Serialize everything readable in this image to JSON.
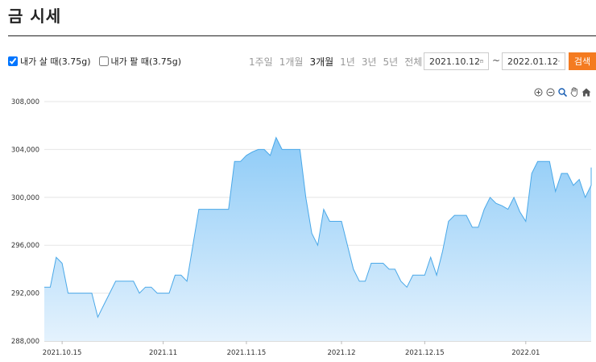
{
  "page": {
    "title": "금 시세"
  },
  "legend": {
    "buy_label": "내가 살 때(3.75g)",
    "buy_checked": true,
    "sell_label": "내가 팔 때(3.75g)",
    "sell_checked": false
  },
  "periods": [
    "1주일",
    "1개월",
    "3개월",
    "1년",
    "3년",
    "5년",
    "전체"
  ],
  "active_period": "3개월",
  "dates": {
    "start": "2021.10.12",
    "end": "2022.01.12",
    "separator": "~"
  },
  "search_label": "검색",
  "toolbar_icons": [
    "zoom-in-icon",
    "zoom-out-icon",
    "zoom-select-icon",
    "pan-hand-icon",
    "home-icon"
  ],
  "colors": {
    "accent": "#f47b20",
    "line": "#4aa8e8",
    "fill_top": "#8ecbf7",
    "fill_bottom": "#e4f2fd"
  },
  "chart_data": {
    "type": "area",
    "yticks": [
      288000,
      292000,
      296000,
      300000,
      304000,
      308000
    ],
    "ytick_labels": [
      "288,000",
      "292,000",
      "296,000",
      "300,000",
      "304,000",
      "308,000"
    ],
    "ylim": [
      288000,
      308000
    ],
    "xlim": [
      "2021-10-12",
      "2022-01-12"
    ],
    "xticks": [
      "2021-10-15",
      "2021-11-01",
      "2021-11-15",
      "2021-12-01",
      "2021-12-15",
      "2022-01-01"
    ],
    "xtick_labels": [
      "2021.10.15",
      "2021.11",
      "2021.11.15",
      "2021.12",
      "2021.12.15",
      "2022.01"
    ],
    "grid": true,
    "series": [
      {
        "values": [
          [
            "2021-10-12",
            292500
          ],
          [
            "2021-10-13",
            292500
          ],
          [
            "2021-10-14",
            295000
          ],
          [
            "2021-10-15",
            294500
          ],
          [
            "2021-10-16",
            292000
          ],
          [
            "2021-10-18",
            292000
          ],
          [
            "2021-10-20",
            292000
          ],
          [
            "2021-10-21",
            290000
          ],
          [
            "2021-10-22",
            291000
          ],
          [
            "2021-10-23",
            292000
          ],
          [
            "2021-10-24",
            293000
          ],
          [
            "2021-10-25",
            293000
          ],
          [
            "2021-10-27",
            293000
          ],
          [
            "2021-10-28",
            292000
          ],
          [
            "2021-10-29",
            292500
          ],
          [
            "2021-10-30",
            292500
          ],
          [
            "2021-10-31",
            292000
          ],
          [
            "2021-11-02",
            292000
          ],
          [
            "2021-11-03",
            293500
          ],
          [
            "2021-11-04",
            293500
          ],
          [
            "2021-11-05",
            293000
          ],
          [
            "2021-11-06",
            296000
          ],
          [
            "2021-11-07",
            299000
          ],
          [
            "2021-11-08",
            299000
          ],
          [
            "2021-11-10",
            299000
          ],
          [
            "2021-11-12",
            299000
          ],
          [
            "2021-11-13",
            303000
          ],
          [
            "2021-11-14",
            303000
          ],
          [
            "2021-11-15",
            303500
          ],
          [
            "2021-11-16",
            303800
          ],
          [
            "2021-11-17",
            304000
          ],
          [
            "2021-11-18",
            304000
          ],
          [
            "2021-11-19",
            303500
          ],
          [
            "2021-11-20",
            305000
          ],
          [
            "2021-11-21",
            304000
          ],
          [
            "2021-11-23",
            304000
          ],
          [
            "2021-11-24",
            304000
          ],
          [
            "2021-11-25",
            300000
          ],
          [
            "2021-11-26",
            297000
          ],
          [
            "2021-11-27",
            296000
          ],
          [
            "2021-11-28",
            299000
          ],
          [
            "2021-11-29",
            298000
          ],
          [
            "2021-11-30",
            298000
          ],
          [
            "2021-12-01",
            298000
          ],
          [
            "2021-12-02",
            296000
          ],
          [
            "2021-12-03",
            294000
          ],
          [
            "2021-12-04",
            293000
          ],
          [
            "2021-12-05",
            293000
          ],
          [
            "2021-12-06",
            294500
          ],
          [
            "2021-12-07",
            294500
          ],
          [
            "2021-12-08",
            294500
          ],
          [
            "2021-12-09",
            294000
          ],
          [
            "2021-12-10",
            294000
          ],
          [
            "2021-12-11",
            293000
          ],
          [
            "2021-12-12",
            292500
          ],
          [
            "2021-12-13",
            293500
          ],
          [
            "2021-12-14",
            293500
          ],
          [
            "2021-12-15",
            293500
          ],
          [
            "2021-12-16",
            295000
          ],
          [
            "2021-12-17",
            293500
          ],
          [
            "2021-12-18",
            295500
          ],
          [
            "2021-12-19",
            298000
          ],
          [
            "2021-12-20",
            298500
          ],
          [
            "2021-12-21",
            298500
          ],
          [
            "2021-12-22",
            298500
          ],
          [
            "2021-12-23",
            297500
          ],
          [
            "2021-12-24",
            297500
          ],
          [
            "2021-12-25",
            299000
          ],
          [
            "2021-12-26",
            300000
          ],
          [
            "2021-12-27",
            299500
          ],
          [
            "2021-12-28",
            299300
          ],
          [
            "2021-12-29",
            299000
          ],
          [
            "2021-12-30",
            300000
          ],
          [
            "2021-12-31",
            298800
          ],
          [
            "2022-01-01",
            298000
          ],
          [
            "2022-01-02",
            302000
          ],
          [
            "2022-01-03",
            303000
          ],
          [
            "2022-01-04",
            303000
          ],
          [
            "2022-01-05",
            303000
          ],
          [
            "2022-01-06",
            300500
          ],
          [
            "2022-01-07",
            302000
          ],
          [
            "2022-01-08",
            302000
          ],
          [
            "2022-01-09",
            301000
          ],
          [
            "2022-01-10",
            301500
          ],
          [
            "2022-01-11",
            300000
          ],
          [
            "2022-01-12",
            301000
          ],
          [
            "2022-01-13",
            302500
          ]
        ]
      }
    ]
  }
}
